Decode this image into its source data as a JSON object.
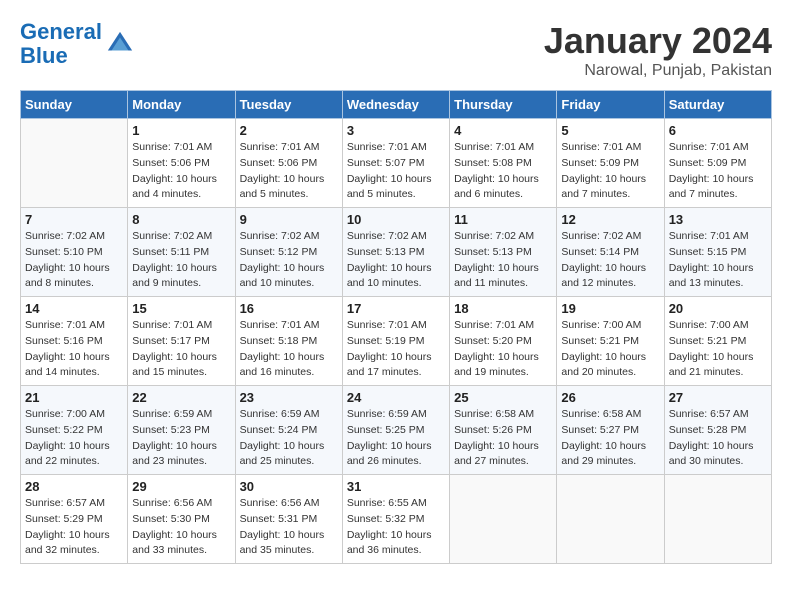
{
  "header": {
    "logo_line1": "General",
    "logo_line2": "Blue",
    "title": "January 2024",
    "subtitle": "Narowal, Punjab, Pakistan"
  },
  "calendar": {
    "days_of_week": [
      "Sunday",
      "Monday",
      "Tuesday",
      "Wednesday",
      "Thursday",
      "Friday",
      "Saturday"
    ],
    "weeks": [
      [
        {
          "day": "",
          "info": ""
        },
        {
          "day": "1",
          "info": "Sunrise: 7:01 AM\nSunset: 5:06 PM\nDaylight: 10 hours\nand 4 minutes."
        },
        {
          "day": "2",
          "info": "Sunrise: 7:01 AM\nSunset: 5:06 PM\nDaylight: 10 hours\nand 5 minutes."
        },
        {
          "day": "3",
          "info": "Sunrise: 7:01 AM\nSunset: 5:07 PM\nDaylight: 10 hours\nand 5 minutes."
        },
        {
          "day": "4",
          "info": "Sunrise: 7:01 AM\nSunset: 5:08 PM\nDaylight: 10 hours\nand 6 minutes."
        },
        {
          "day": "5",
          "info": "Sunrise: 7:01 AM\nSunset: 5:09 PM\nDaylight: 10 hours\nand 7 minutes."
        },
        {
          "day": "6",
          "info": "Sunrise: 7:01 AM\nSunset: 5:09 PM\nDaylight: 10 hours\nand 7 minutes."
        }
      ],
      [
        {
          "day": "7",
          "info": "Sunrise: 7:02 AM\nSunset: 5:10 PM\nDaylight: 10 hours\nand 8 minutes."
        },
        {
          "day": "8",
          "info": "Sunrise: 7:02 AM\nSunset: 5:11 PM\nDaylight: 10 hours\nand 9 minutes."
        },
        {
          "day": "9",
          "info": "Sunrise: 7:02 AM\nSunset: 5:12 PM\nDaylight: 10 hours\nand 10 minutes."
        },
        {
          "day": "10",
          "info": "Sunrise: 7:02 AM\nSunset: 5:13 PM\nDaylight: 10 hours\nand 10 minutes."
        },
        {
          "day": "11",
          "info": "Sunrise: 7:02 AM\nSunset: 5:13 PM\nDaylight: 10 hours\nand 11 minutes."
        },
        {
          "day": "12",
          "info": "Sunrise: 7:02 AM\nSunset: 5:14 PM\nDaylight: 10 hours\nand 12 minutes."
        },
        {
          "day": "13",
          "info": "Sunrise: 7:01 AM\nSunset: 5:15 PM\nDaylight: 10 hours\nand 13 minutes."
        }
      ],
      [
        {
          "day": "14",
          "info": "Sunrise: 7:01 AM\nSunset: 5:16 PM\nDaylight: 10 hours\nand 14 minutes."
        },
        {
          "day": "15",
          "info": "Sunrise: 7:01 AM\nSunset: 5:17 PM\nDaylight: 10 hours\nand 15 minutes."
        },
        {
          "day": "16",
          "info": "Sunrise: 7:01 AM\nSunset: 5:18 PM\nDaylight: 10 hours\nand 16 minutes."
        },
        {
          "day": "17",
          "info": "Sunrise: 7:01 AM\nSunset: 5:19 PM\nDaylight: 10 hours\nand 17 minutes."
        },
        {
          "day": "18",
          "info": "Sunrise: 7:01 AM\nSunset: 5:20 PM\nDaylight: 10 hours\nand 19 minutes."
        },
        {
          "day": "19",
          "info": "Sunrise: 7:00 AM\nSunset: 5:21 PM\nDaylight: 10 hours\nand 20 minutes."
        },
        {
          "day": "20",
          "info": "Sunrise: 7:00 AM\nSunset: 5:21 PM\nDaylight: 10 hours\nand 21 minutes."
        }
      ],
      [
        {
          "day": "21",
          "info": "Sunrise: 7:00 AM\nSunset: 5:22 PM\nDaylight: 10 hours\nand 22 minutes."
        },
        {
          "day": "22",
          "info": "Sunrise: 6:59 AM\nSunset: 5:23 PM\nDaylight: 10 hours\nand 23 minutes."
        },
        {
          "day": "23",
          "info": "Sunrise: 6:59 AM\nSunset: 5:24 PM\nDaylight: 10 hours\nand 25 minutes."
        },
        {
          "day": "24",
          "info": "Sunrise: 6:59 AM\nSunset: 5:25 PM\nDaylight: 10 hours\nand 26 minutes."
        },
        {
          "day": "25",
          "info": "Sunrise: 6:58 AM\nSunset: 5:26 PM\nDaylight: 10 hours\nand 27 minutes."
        },
        {
          "day": "26",
          "info": "Sunrise: 6:58 AM\nSunset: 5:27 PM\nDaylight: 10 hours\nand 29 minutes."
        },
        {
          "day": "27",
          "info": "Sunrise: 6:57 AM\nSunset: 5:28 PM\nDaylight: 10 hours\nand 30 minutes."
        }
      ],
      [
        {
          "day": "28",
          "info": "Sunrise: 6:57 AM\nSunset: 5:29 PM\nDaylight: 10 hours\nand 32 minutes."
        },
        {
          "day": "29",
          "info": "Sunrise: 6:56 AM\nSunset: 5:30 PM\nDaylight: 10 hours\nand 33 minutes."
        },
        {
          "day": "30",
          "info": "Sunrise: 6:56 AM\nSunset: 5:31 PM\nDaylight: 10 hours\nand 35 minutes."
        },
        {
          "day": "31",
          "info": "Sunrise: 6:55 AM\nSunset: 5:32 PM\nDaylight: 10 hours\nand 36 minutes."
        },
        {
          "day": "",
          "info": ""
        },
        {
          "day": "",
          "info": ""
        },
        {
          "day": "",
          "info": ""
        }
      ]
    ]
  }
}
